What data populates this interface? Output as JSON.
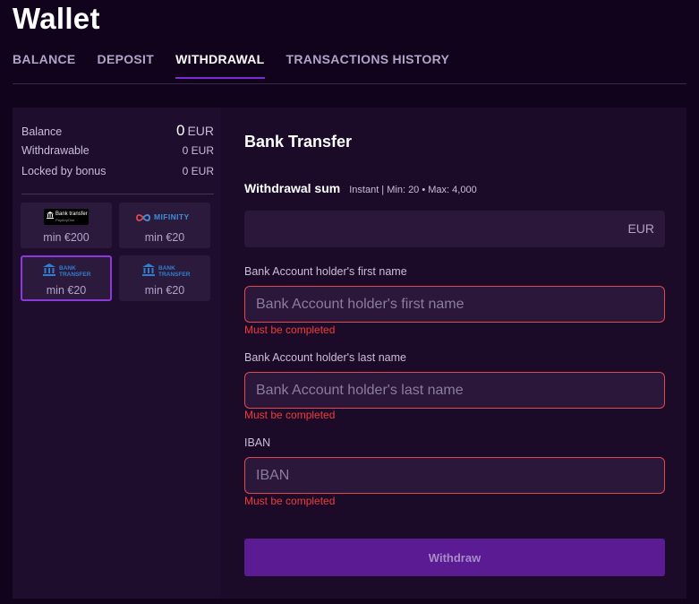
{
  "page": {
    "title": "Wallet"
  },
  "tabs": [
    {
      "label": "BALANCE",
      "active": false
    },
    {
      "label": "DEPOSIT",
      "active": false
    },
    {
      "label": "WITHDRAWAL",
      "active": true
    },
    {
      "label": "TRANSACTIONS HISTORY",
      "active": false
    }
  ],
  "balance": {
    "balance_label": "Balance",
    "balance_amount": "0",
    "balance_currency": "EUR",
    "withdrawable_label": "Withdrawable",
    "withdrawable_value": "0 EUR",
    "locked_label": "Locked by bonus",
    "locked_value": "0 EUR"
  },
  "methods": [
    {
      "logo_title": "Bank transfer",
      "logo_sub": "PayAnyOne",
      "min": "min €200",
      "selected": false,
      "icon": "bank-transfer-logo"
    },
    {
      "logo_title": "MIFINITY",
      "min": "min €20",
      "selected": false,
      "icon": "mifinity-logo"
    },
    {
      "logo_title": "BANK\nTRANSFER",
      "min": "min €20",
      "selected": true,
      "icon": "bank-transfer-blue-logo"
    },
    {
      "logo_title": "BANK\nTRANSFER",
      "min": "min €20",
      "selected": false,
      "icon": "bank-transfer-blue-logo"
    }
  ],
  "form": {
    "title": "Bank Transfer",
    "sum_label": "Withdrawal sum",
    "sum_info": "Instant | Min: 20 • Max: 4,000",
    "currency": "EUR",
    "first_name": {
      "label": "Bank Account holder's first name",
      "placeholder": "Bank Account holder's first name",
      "value": "",
      "error": "Must be completed"
    },
    "last_name": {
      "label": "Bank Account holder's last name",
      "placeholder": "Bank Account holder's last name",
      "value": "",
      "error": "Must be completed"
    },
    "iban": {
      "label": "IBAN",
      "placeholder": "IBAN",
      "value": "",
      "error": "Must be completed"
    },
    "submit_label": "Withdraw"
  },
  "colors": {
    "background": "#12031c",
    "panel": "#1e0d2c",
    "accent": "#7b2bd2",
    "button": "#5a1b93",
    "error": "#f03a3a",
    "mifinity_blue": "#3a8fd9"
  }
}
